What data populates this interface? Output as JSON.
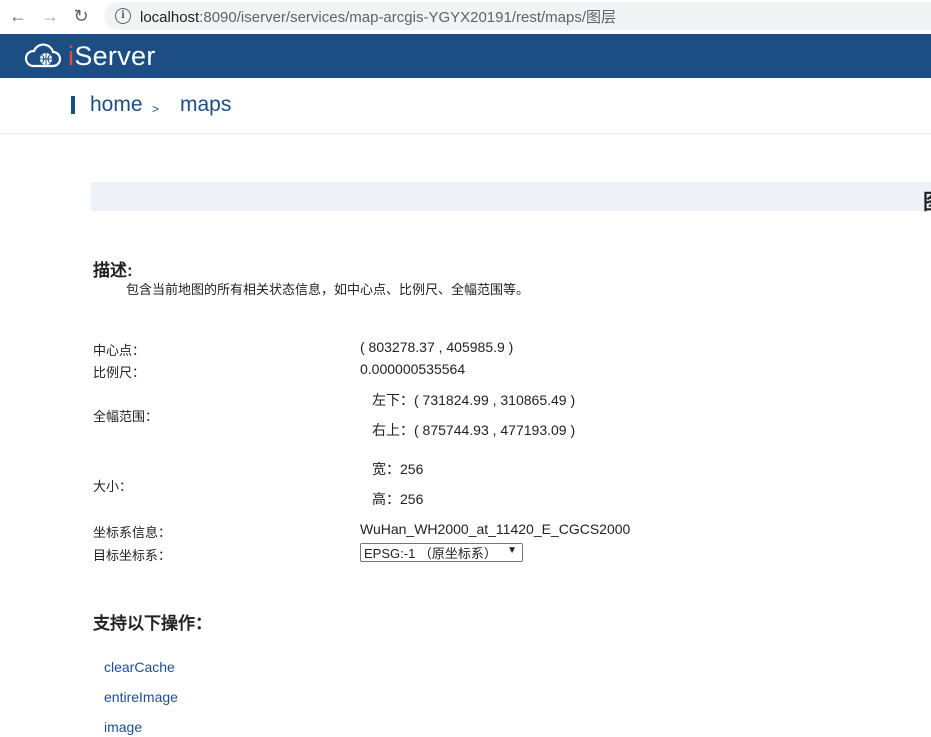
{
  "browser": {
    "back_glyph": "←",
    "forward_glyph": "→",
    "reload_glyph": "↻",
    "info_glyph": "i",
    "url_host": "localhost",
    "url_path": ":8090/iserver/services/map-arcgis-YGYX20191/rest/maps/图层"
  },
  "header": {
    "logo_prefix": "i",
    "logo_rest": "Server",
    "accent_color": "#e84b3c",
    "bar_color": "#1c4e84"
  },
  "breadcrumb": {
    "home": "home",
    "separator": ">",
    "current": "maps"
  },
  "title_band": {
    "glyph": "图"
  },
  "description": {
    "heading": "描述:",
    "text": "包含当前地图的所有相关状态信息，如中心点、比例尺、全幅范围等。"
  },
  "properties": {
    "center_label": "中心点：",
    "center_value": "( 803278.37 , 405985.9 )",
    "scale_label": "比例尺：",
    "scale_value": "0.000000535564",
    "bounds_label": "全幅范围：",
    "bounds_lower_left": "左下：( 731824.99 , 310865.49 )",
    "bounds_upper_right": "右上：( 875744.93 , 477193.09 )",
    "size_label": "大小：",
    "size_width": "宽：256",
    "size_height": "高：256",
    "crs_label": "坐标系信息：",
    "crs_value": "WuHan_WH2000_at_11420_E_CGCS2000",
    "target_crs_label": "目标坐标系：",
    "target_crs_selected": "EPSG:-1 （原坐标系）",
    "select_caret": "▼"
  },
  "operations": {
    "heading": "支持以下操作：",
    "items": [
      "clearCache",
      "entireImage",
      "image"
    ]
  }
}
